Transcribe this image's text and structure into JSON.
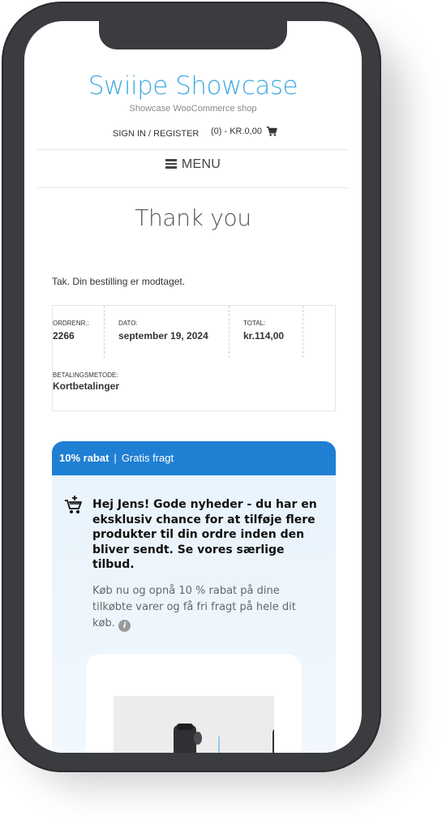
{
  "site": {
    "title": "Swiipe Showcase",
    "tagline": "Showcase WooCommerce shop"
  },
  "header": {
    "signin_label": "SIGN IN / REGISTER",
    "cart_label": "(0) - KR.0,00",
    "cart_icon": "cart-icon"
  },
  "nav": {
    "menu_label": "MENU",
    "menu_icon": "hamburger-icon"
  },
  "page": {
    "title": "Thank you",
    "received_text": "Tak. Din bestilling er modtaget."
  },
  "order": {
    "number_label": "ORDRENR.:",
    "number": "2266",
    "date_label": "DATO:",
    "date": "september 19, 2024",
    "total_label": "TOTAL:",
    "total": "kr.114,00",
    "payment_label": "BETALINGSMETODE:",
    "payment": "Kortbetalinger"
  },
  "offer": {
    "badge_discount": "10% rabat",
    "separator": "|",
    "badge_shipping": "Gratis fragt",
    "heading": "Hej Jens! Gode nyheder - du har en eksklusiv chance for at tilføje flere produkter til din ordre inden den bliver sendt. Se vores særlige tilbud.",
    "description": "Køb nu og opnå 10 % rabat på dine tilkøbte varer og få fri fragt på hele dit køb.",
    "info_icon": "info-icon",
    "basket_icon": "shopping-basket-icon"
  },
  "colors": {
    "brand": "#3fa9e0",
    "offer_header": "#1e7fd3",
    "offer_background": "#e8f3fc",
    "phone_frame": "#3a3c40"
  }
}
